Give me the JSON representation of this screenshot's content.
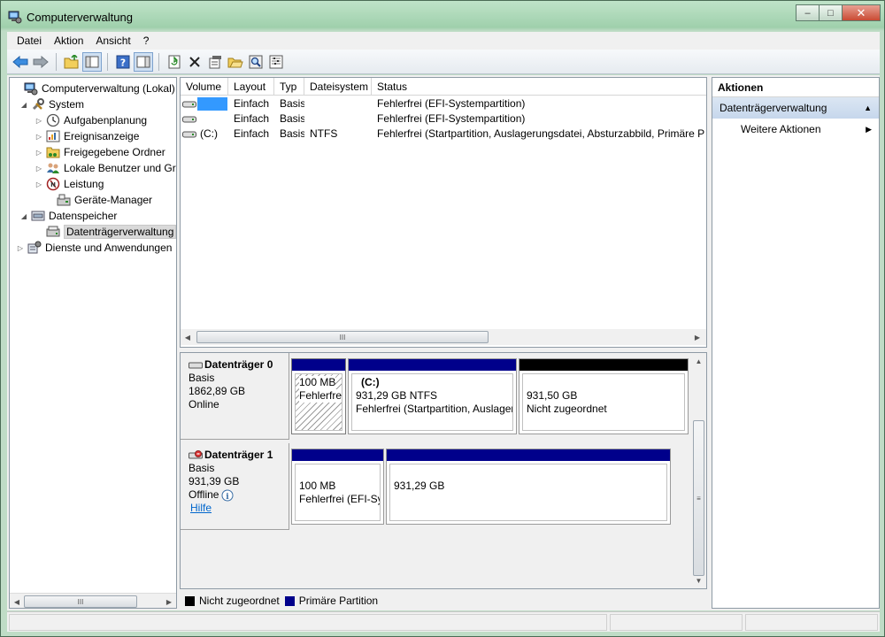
{
  "window": {
    "title": "Computerverwaltung",
    "controls": {
      "minimize": "‒",
      "maximize": "□",
      "close": "✕"
    }
  },
  "menu": [
    "Datei",
    "Aktion",
    "Ansicht",
    "?"
  ],
  "toolbar": [
    "back-icon",
    "forward-icon",
    "up-folder-icon",
    "show-tree-icon",
    "help-icon",
    "show-action-pane-icon",
    "refresh-icon",
    "delete-icon",
    "properties-icon",
    "open-icon",
    "search-icon",
    "settings-icon"
  ],
  "tree": {
    "items": [
      {
        "label": "Computerverwaltung (Lokal)",
        "expander": "",
        "icon": "computer-icon"
      },
      {
        "label": "System",
        "expander": "◢",
        "icon": "tools-icon"
      },
      {
        "label": "Aufgabenplanung",
        "expander": "▷",
        "icon": "clock-icon"
      },
      {
        "label": "Ereignisanzeige",
        "expander": "▷",
        "icon": "event-viewer-icon"
      },
      {
        "label": "Freigegebene Ordner",
        "expander": "▷",
        "icon": "shared-folder-icon"
      },
      {
        "label": "Lokale Benutzer und Gruppen",
        "expander": "▷",
        "icon": "users-icon"
      },
      {
        "label": "Leistung",
        "expander": "▷",
        "icon": "performance-icon"
      },
      {
        "label": "Geräte-Manager",
        "expander": "",
        "icon": "device-manager-icon"
      },
      {
        "label": "Datenspeicher",
        "expander": "◢",
        "icon": "storage-icon"
      },
      {
        "label": "Datenträgerverwaltung",
        "expander": "",
        "icon": "disk-management-icon"
      },
      {
        "label": "Dienste und Anwendungen",
        "expander": "▷",
        "icon": "services-icon"
      }
    ]
  },
  "volumes": {
    "columns": [
      "Volume",
      "Layout",
      "Typ",
      "Dateisystem",
      "Status"
    ],
    "rows": [
      {
        "volume": "",
        "layout": "Einfach",
        "typ": "Basis",
        "dateisystem": "",
        "status": "Fehlerfrei (EFI-Systempartition)"
      },
      {
        "volume": "",
        "layout": "Einfach",
        "typ": "Basis",
        "dateisystem": "",
        "status": "Fehlerfrei (EFI-Systempartition)"
      },
      {
        "volume": "(C:)",
        "layout": "Einfach",
        "typ": "Basis",
        "dateisystem": "NTFS",
        "status": "Fehlerfrei (Startpartition, Auslagerungsdatei, Absturzabbild, Primäre Partition)"
      }
    ],
    "scroll_thumb": "III"
  },
  "disks": [
    {
      "name": "Datenträger 0",
      "type": "Basis",
      "size": "1862,89 GB",
      "state": "Online",
      "partitions": [
        {
          "title": "",
          "size": "100 MB",
          "status": "Fehlerfrei (EFI-Systempartition)"
        },
        {
          "title": "(C:)",
          "size": "931,29 GB NTFS",
          "status": "Fehlerfrei (Startpartition, Auslagerungsdatei)"
        },
        {
          "title": "",
          "size": "931,50 GB",
          "status": "Nicht zugeordnet"
        }
      ]
    },
    {
      "name": "Datenträger 1",
      "type": "Basis",
      "size": "931,39 GB",
      "state": "Offline",
      "help_link": "Hilfe",
      "partitions": [
        {
          "title": "",
          "size": "100 MB",
          "status": "Fehlerfrei (EFI-Systempartition)"
        },
        {
          "title": "",
          "size": "931,29 GB",
          "status": ""
        }
      ]
    }
  ],
  "legend": [
    {
      "label": "Nicht zugeordnet",
      "color": "#000000"
    },
    {
      "label": "Primäre Partition",
      "color": "#00008b"
    }
  ],
  "actions": {
    "header": "Aktionen",
    "group": "Datenträgerverwaltung",
    "group_arrow": "▲",
    "items": [
      {
        "label": "Weitere Aktionen",
        "arrow": "▶"
      }
    ]
  },
  "colors": {
    "primary_partition": "#00008b",
    "unallocated": "#000000",
    "selection": "#3399ff"
  }
}
